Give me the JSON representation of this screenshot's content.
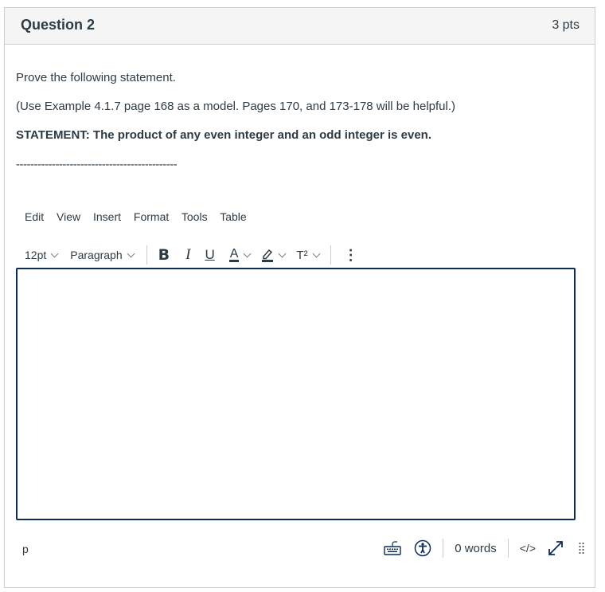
{
  "header": {
    "title": "Question 2",
    "points": "3 pts"
  },
  "body": {
    "line1": "Prove the following statement.",
    "line2": "(Use Example 4.1.7 page 168 as a model.  Pages 170, and 173-178 will be helpful.)",
    "statement": "STATEMENT: The product of any even integer and an odd integer is even.",
    "divider": "---------------------------------------------"
  },
  "editor": {
    "menu": [
      "Edit",
      "View",
      "Insert",
      "Format",
      "Tools",
      "Table"
    ],
    "font_size": "12pt",
    "block_format": "Paragraph",
    "buttons": {
      "bold": "B",
      "italic": "I",
      "underline": "U",
      "font_color": "A",
      "superscript": "T²",
      "more": "⋮"
    },
    "content": "",
    "status": {
      "path": "p",
      "word_count": "0 words",
      "html_toggle": "</>"
    },
    "colors": {
      "border": "#0b2c5d",
      "text": "#2d3b45"
    }
  }
}
